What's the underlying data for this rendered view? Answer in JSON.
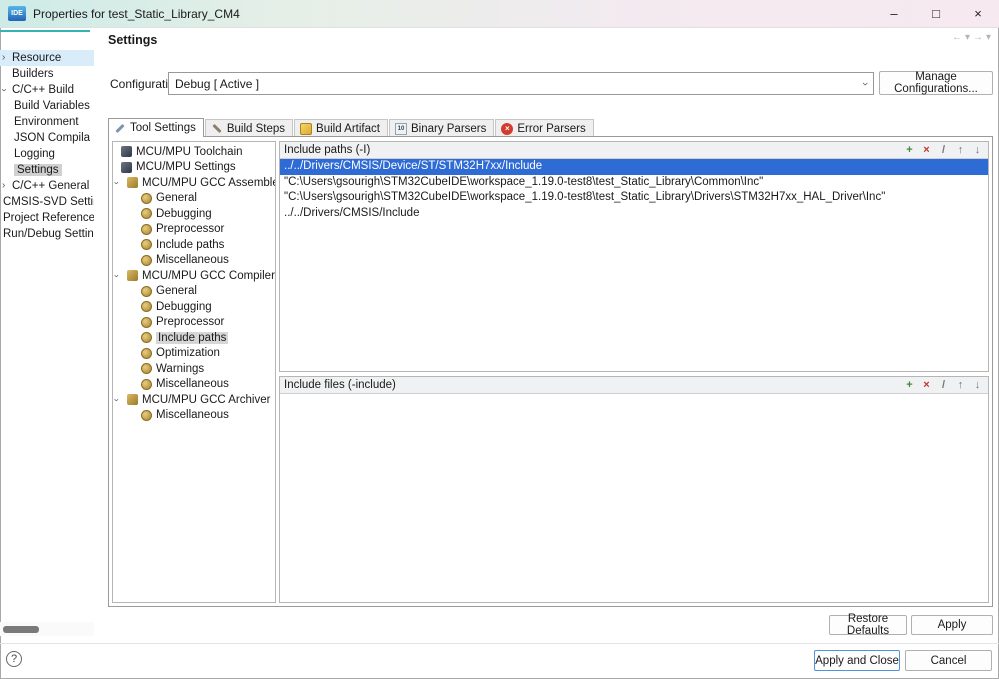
{
  "window": {
    "title": "Properties for test_Static_Library_CM4",
    "app_icon_label": "IDE",
    "controls": {
      "minimize": "–",
      "maximize": "□",
      "close": "×"
    }
  },
  "nav": {
    "back": "←",
    "forward": "→",
    "menu": "▾"
  },
  "icons": {
    "chevron": "›"
  },
  "colors": {
    "accent_teal": "#35b2b2",
    "selection_blue": "#2e6bd4",
    "selected_gray": "#d6d6d6",
    "default_button_border": "#4f94d8"
  },
  "sidebar": {
    "items": [
      {
        "label": "Resource",
        "arrow": ">",
        "indent": "0",
        "state": "hover"
      },
      {
        "label": "Builders",
        "indent": "0"
      },
      {
        "label": "C/C++ Build",
        "arrow": "v",
        "indent": "0"
      },
      {
        "label": "Build Variables",
        "indent": "1"
      },
      {
        "label": "Environment",
        "indent": "1"
      },
      {
        "label": "JSON Compila",
        "indent": "1"
      },
      {
        "label": "Logging",
        "indent": "1"
      },
      {
        "label": "Settings",
        "indent": "1",
        "state": "selected"
      },
      {
        "label": "C/C++ General",
        "arrow": ">",
        "indent": "0"
      },
      {
        "label": "CMSIS-SVD Settin",
        "indent": "F"
      },
      {
        "label": "Project Reference",
        "indent": "F"
      },
      {
        "label": "Run/Debug Settin",
        "indent": "F"
      }
    ]
  },
  "header": {
    "title": "Settings"
  },
  "configuration": {
    "label": "Configuration:",
    "value": "Debug  [ Active ]",
    "manage_button": "Manage Configurations..."
  },
  "tabs": [
    {
      "label": "Tool Settings",
      "icon": "wrench-icon",
      "active": true
    },
    {
      "label": "Build Steps",
      "icon": "hammer-icon",
      "active": false
    },
    {
      "label": "Build Artifact",
      "icon": "package-icon",
      "active": false
    },
    {
      "label": "Binary Parsers",
      "icon": "binary-icon",
      "active": false
    },
    {
      "label": "Error Parsers",
      "icon": "error-icon",
      "active": false
    }
  ],
  "tool_tree": [
    {
      "label": "MCU/MPU Toolchain",
      "level": 0,
      "chevron": false,
      "icon": "tool-dark"
    },
    {
      "label": "MCU/MPU Settings",
      "level": 0,
      "chevron": false,
      "icon": "tool-dark"
    },
    {
      "label": "MCU/MPU GCC Assembler",
      "level": 0,
      "chevron": true,
      "icon": "tool"
    },
    {
      "label": "General",
      "level": 1,
      "icon": "gear"
    },
    {
      "label": "Debugging",
      "level": 1,
      "icon": "gear"
    },
    {
      "label": "Preprocessor",
      "level": 1,
      "icon": "gear"
    },
    {
      "label": "Include paths",
      "level": 1,
      "icon": "gear"
    },
    {
      "label": "Miscellaneous",
      "level": 1,
      "icon": "gear"
    },
    {
      "label": "MCU/MPU GCC Compiler",
      "level": 0,
      "chevron": true,
      "icon": "tool"
    },
    {
      "label": "General",
      "level": 1,
      "icon": "gear"
    },
    {
      "label": "Debugging",
      "level": 1,
      "icon": "gear"
    },
    {
      "label": "Preprocessor",
      "level": 1,
      "icon": "gear"
    },
    {
      "label": "Include paths",
      "level": 1,
      "icon": "gear",
      "selected": true
    },
    {
      "label": "Optimization",
      "level": 1,
      "icon": "gear"
    },
    {
      "label": "Warnings",
      "level": 1,
      "icon": "gear"
    },
    {
      "label": "Miscellaneous",
      "level": 1,
      "icon": "gear"
    },
    {
      "label": "MCU/MPU GCC Archiver",
      "level": 0,
      "chevron": true,
      "icon": "tool"
    },
    {
      "label": "Miscellaneous",
      "level": 1,
      "icon": "gear"
    }
  ],
  "list_toolbar": [
    {
      "name": "add-icon",
      "glyph": "+",
      "color": "#3d8b3d"
    },
    {
      "name": "delete-icon",
      "glyph": "×",
      "color": "#c0392b"
    },
    {
      "name": "edit-icon",
      "glyph": "/",
      "color": "#777777"
    },
    {
      "name": "move-up-icon",
      "glyph": "↑",
      "color": "#667788"
    },
    {
      "name": "move-down-icon",
      "glyph": "↓",
      "color": "#667788"
    }
  ],
  "include_paths": {
    "title": "Include paths (-I)",
    "items": [
      {
        "text": "../../Drivers/CMSIS/Device/ST/STM32H7xx/Include",
        "selected": true
      },
      {
        "text": "\"C:\\Users\\gsourigh\\STM32CubeIDE\\workspace_1.19.0-test8\\test_Static_Library\\Common\\Inc\""
      },
      {
        "text": "\"C:\\Users\\gsourigh\\STM32CubeIDE\\workspace_1.19.0-test8\\test_Static_Library\\Drivers\\STM32H7xx_HAL_Driver\\Inc\""
      },
      {
        "text": "../../Drivers/CMSIS/Include"
      }
    ]
  },
  "include_files": {
    "title": "Include files (-include)",
    "items": []
  },
  "footer": {
    "restore_defaults": "Restore Defaults",
    "apply": "Apply",
    "help_glyph": "?",
    "apply_and_close": "Apply and Close",
    "cancel": "Cancel"
  }
}
